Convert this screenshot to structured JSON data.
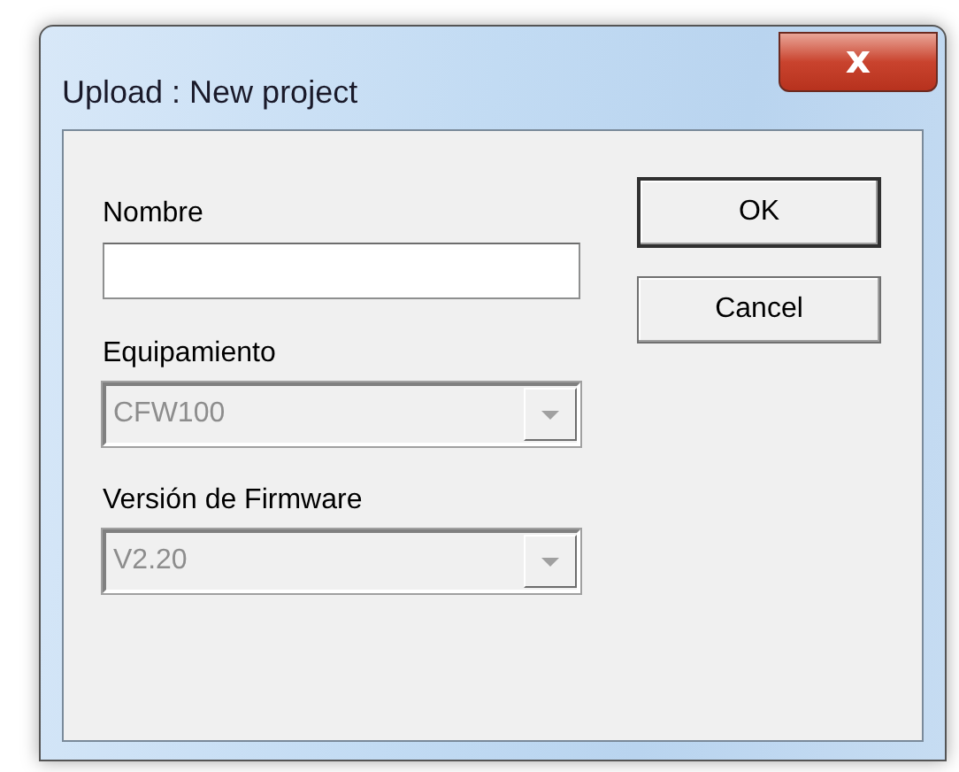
{
  "window": {
    "title": "Upload : New project",
    "close_label": "x"
  },
  "fields": [
    {
      "label": "Nombre",
      "kind": "text",
      "disabled": false
    },
    {
      "label": "Equipamiento",
      "kind": "combo",
      "value": "CFW100",
      "disabled": true
    },
    {
      "label": "Versión de Firmware",
      "kind": "combo",
      "value": "V2.20",
      "disabled": true
    }
  ],
  "buttons": [
    {
      "label": "OK",
      "default": true
    },
    {
      "label": "Cancel",
      "default": false
    }
  ]
}
